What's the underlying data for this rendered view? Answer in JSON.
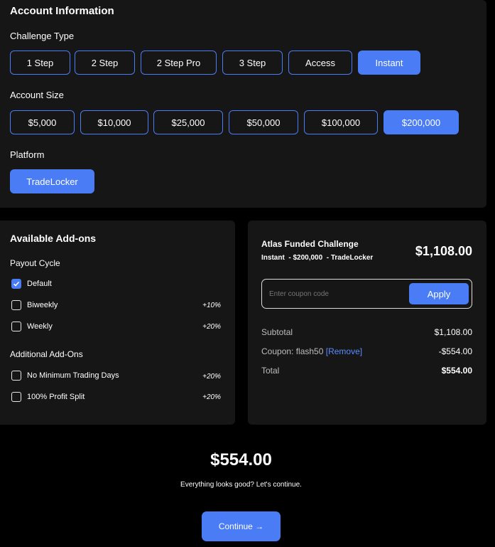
{
  "account": {
    "title": "Account Information",
    "challenge_type": {
      "label": "Challenge Type",
      "options": [
        "1 Step",
        "2 Step",
        "2 Step Pro",
        "3 Step",
        "Access",
        "Instant"
      ],
      "selected": "Instant"
    },
    "account_size": {
      "label": "Account Size",
      "options": [
        "$5,000",
        "$10,000",
        "$25,000",
        "$50,000",
        "$100,000",
        "$200,000"
      ],
      "selected": "$200,000"
    },
    "platform": {
      "label": "Platform",
      "options": [
        "TradeLocker"
      ],
      "selected": "TradeLocker"
    }
  },
  "addons": {
    "title": "Available Add-ons",
    "payout_cycle": {
      "label": "Payout Cycle",
      "items": [
        {
          "label": "Default",
          "checked": true,
          "pct": ""
        },
        {
          "label": "Biweekly",
          "checked": false,
          "pct": "+10%"
        },
        {
          "label": "Weekly",
          "checked": false,
          "pct": "+20%"
        }
      ]
    },
    "additional": {
      "label": "Additional Add-Ons",
      "items": [
        {
          "label": "No Minimum Trading Days",
          "checked": false,
          "pct": "+20%"
        },
        {
          "label": "100% Profit Split",
          "checked": false,
          "pct": "+20%"
        }
      ]
    }
  },
  "summary": {
    "product_name": "Atlas Funded Challenge",
    "product_detail": "Instant  - $200,000  - TradeLocker",
    "price": "$1,108.00",
    "coupon_placeholder": "Enter coupon code",
    "apply_label": "Apply",
    "subtotal_label": "Subtotal",
    "subtotal_value": "$1,108.00",
    "coupon_label": "Coupon: flash50",
    "coupon_remove": "[Remove]",
    "coupon_value": "-$554.00",
    "total_label": "Total",
    "total_value": "$554.00"
  },
  "footer": {
    "total": "$554.00",
    "message": "Everything looks good? Let's continue.",
    "continue_label": "Continue →"
  },
  "colors": {
    "accent": "#4a7cf5",
    "panel": "#161616",
    "background": "#000000"
  }
}
